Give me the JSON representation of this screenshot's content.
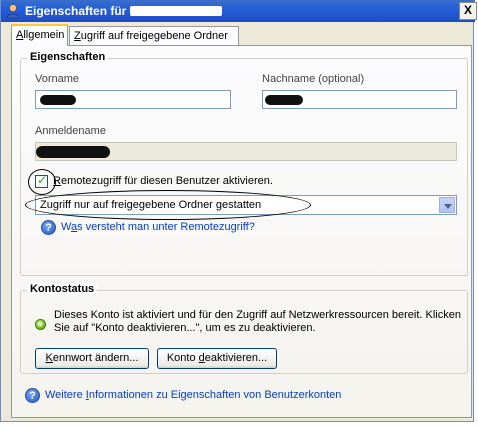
{
  "window": {
    "title": "Eigenschaften für",
    "close_glyph": "X"
  },
  "tabs": [
    {
      "label_underline": "A",
      "label_rest": "llgemein",
      "active": true
    },
    {
      "label_underline": "Z",
      "label_rest": "ugriff auf freigegebene Ordner",
      "active": false
    }
  ],
  "properties": {
    "legend": "Eigenschaften",
    "vorname_label": "Vorname",
    "nachname_label": "Nachname (optional)",
    "anmeldename_label": "Anmeldename",
    "remote_checkbox_underline": "R",
    "remote_checkbox_rest": "emotezugriff für diesen Benutzer aktivieren.",
    "remote_checked": true,
    "access_selected": "Zugriff nur auf freigegebene Ordner gestatten",
    "help_link_before": "W",
    "help_link_underline": "a",
    "help_link_after": "s versteht man unter Remotezugriff?"
  },
  "account_status": {
    "legend": "Kontostatus",
    "status_line1": "Dieses Konto ist aktiviert und für den Zugriff auf Netzwerkressourcen bereit. Klicken",
    "status_line2": "Sie auf \"Konto deaktivieren...\", um es zu deaktivieren.",
    "btn_password_underline": "K",
    "btn_password_rest": "ennwort ändern...",
    "btn_deactivate_before": "Konto ",
    "btn_deactivate_underline": "d",
    "btn_deactivate_after": "eaktivieren..."
  },
  "footer_link": {
    "before": "Weitere ",
    "underline": "I",
    "after": "nformationen zu Eigenschaften von Benutzerkonten"
  },
  "colors": {
    "titlebar": "#245edb",
    "link": "#0a3cc8",
    "active_tab_accent": "#ffc73c"
  }
}
